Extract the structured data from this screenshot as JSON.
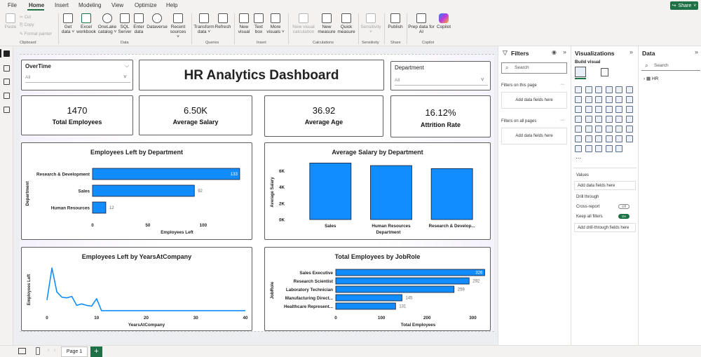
{
  "menu": {
    "items": [
      "File",
      "Home",
      "Insert",
      "Modeling",
      "View",
      "Optimize",
      "Help"
    ],
    "share": "Share"
  },
  "ribbon": {
    "clipboard": {
      "paste": "Paste",
      "cut": "Cut",
      "copy": "Copy",
      "format_painter": "Format painter",
      "label": "Clipboard"
    },
    "data": {
      "get_data": [
        "Get",
        "data ˅"
      ],
      "excel": [
        "Excel",
        "workbook"
      ],
      "onelake": [
        "OneLake",
        "catalog ˅"
      ],
      "sql": [
        "SQL",
        "Server"
      ],
      "enter": [
        "Enter",
        "data"
      ],
      "dataverse": [
        "Dataverse",
        ""
      ],
      "recent": [
        "Recent",
        "sources ˅"
      ],
      "label": "Data"
    },
    "queries": {
      "transform": [
        "Transform",
        "data ˅"
      ],
      "refresh": [
        "Refresh",
        ""
      ],
      "label": "Queries"
    },
    "insert": {
      "new_visual": [
        "New",
        "visual"
      ],
      "text_box": [
        "Text",
        "box"
      ],
      "more_visuals": [
        "More",
        "visuals ˅"
      ],
      "label": "Insert"
    },
    "calculations": {
      "new_visual_calc": [
        "New visual",
        "calculation"
      ],
      "new_measure": [
        "New",
        "measure"
      ],
      "quick_measure": [
        "Quick",
        "measure"
      ],
      "label": "Calculations"
    },
    "sensitivity": {
      "sensitivity": [
        "Sensitivity",
        "˅"
      ],
      "label": "Sensitivity"
    },
    "share": {
      "publish": [
        "Publish",
        ""
      ],
      "label": "Share"
    },
    "copilot": {
      "prep": [
        "Prep data for",
        "AI"
      ],
      "copilot": [
        "Copilot",
        ""
      ],
      "label": "Copilot"
    }
  },
  "report": {
    "title": "HR Analytics Dashboard",
    "slicers": [
      {
        "title": "OverTime",
        "value": "All"
      },
      {
        "title": "Department",
        "value": "All"
      }
    ],
    "kpis": [
      {
        "value": "1470",
        "label": "Total Employees"
      },
      {
        "value": "6.50K",
        "label": "Average Salary"
      },
      {
        "value": "36.92",
        "label": "Average Age"
      },
      {
        "value": "16.12%",
        "label": "Attrition Rate"
      }
    ]
  },
  "chart_data": [
    {
      "type": "bar",
      "orientation": "horizontal",
      "title": "Employees Left by Department",
      "xlabel": "Employees Left",
      "ylabel": "Department",
      "categories": [
        "Research & Development",
        "Sales",
        "Human Resources"
      ],
      "values": [
        133,
        92,
        12
      ],
      "xlim": [
        0,
        140
      ],
      "xticks": [
        "0",
        "50",
        "100"
      ],
      "color": "#118DFF"
    },
    {
      "type": "bar",
      "title": "Average Salary by Department",
      "xlabel": "Department",
      "ylabel": "Average Salary",
      "categories": [
        "Sales",
        "Human Resources",
        "Research & Develop..."
      ],
      "values": [
        6960,
        6650,
        6280
      ],
      "ylim": [
        0,
        7000
      ],
      "yticks": [
        "0K",
        "2K",
        "4K",
        "6K"
      ],
      "color": "#118DFF"
    },
    {
      "type": "line",
      "title": "Employees Left by YearsAtCompany",
      "xlabel": "YearsAtCompany",
      "ylabel": "Employees Left",
      "x": [
        0,
        1,
        2,
        3,
        4,
        5,
        6,
        7,
        8,
        9,
        10,
        11,
        12,
        13,
        14,
        15,
        16,
        17,
        18,
        19,
        20,
        21,
        22,
        23,
        24,
        25,
        26,
        27,
        28,
        29,
        30,
        31,
        32,
        33,
        34,
        35,
        36,
        37,
        38,
        39,
        40
      ],
      "y": [
        16,
        59,
        27,
        20,
        19,
        21,
        9,
        11,
        9,
        8,
        18,
        2,
        2,
        2,
        2,
        2,
        2,
        2,
        2,
        2,
        2,
        2,
        2,
        2,
        2,
        2,
        2,
        2,
        2,
        2,
        2,
        2,
        2,
        2,
        2,
        2,
        2,
        2,
        2,
        2,
        2
      ],
      "xlim": [
        0,
        40
      ],
      "ylim": [
        0,
        60
      ],
      "xticks": [
        "0",
        "10",
        "20",
        "30",
        "40"
      ],
      "color": "#118DFF"
    },
    {
      "type": "bar",
      "orientation": "horizontal",
      "title": "Total Employees by JobRole",
      "xlabel": "Total Employees",
      "ylabel": "JobRole",
      "categories": [
        "Sales Executive",
        "Research Scientist",
        "Laboratory Technician",
        "Manufacturing Direct...",
        "Healthcare Represent..."
      ],
      "values": [
        326,
        292,
        259,
        145,
        131
      ],
      "xlim": [
        0,
        330
      ],
      "xticks": [
        "0",
        "100",
        "200",
        "300"
      ],
      "color": "#118DFF"
    }
  ],
  "filters": {
    "title": "Filters",
    "search": "Search",
    "this_page": "Filters on this page",
    "all_pages": "Filters on all pages",
    "add_fields": "Add data fields here"
  },
  "visualizations": {
    "title": "Visualizations",
    "build": "Build visual",
    "values": "Values",
    "add_fields": "Add data fields here",
    "drill": "Drill through",
    "cross_report": "Cross-report",
    "cross_state": "Off",
    "keep_filters": "Keep all filters",
    "keep_state": "On",
    "add_drill": "Add drill-through fields here"
  },
  "data_pane": {
    "title": "Data",
    "search": "Search",
    "table": "HR"
  },
  "bottom": {
    "page_tab": "Page 1",
    "add": "+"
  }
}
